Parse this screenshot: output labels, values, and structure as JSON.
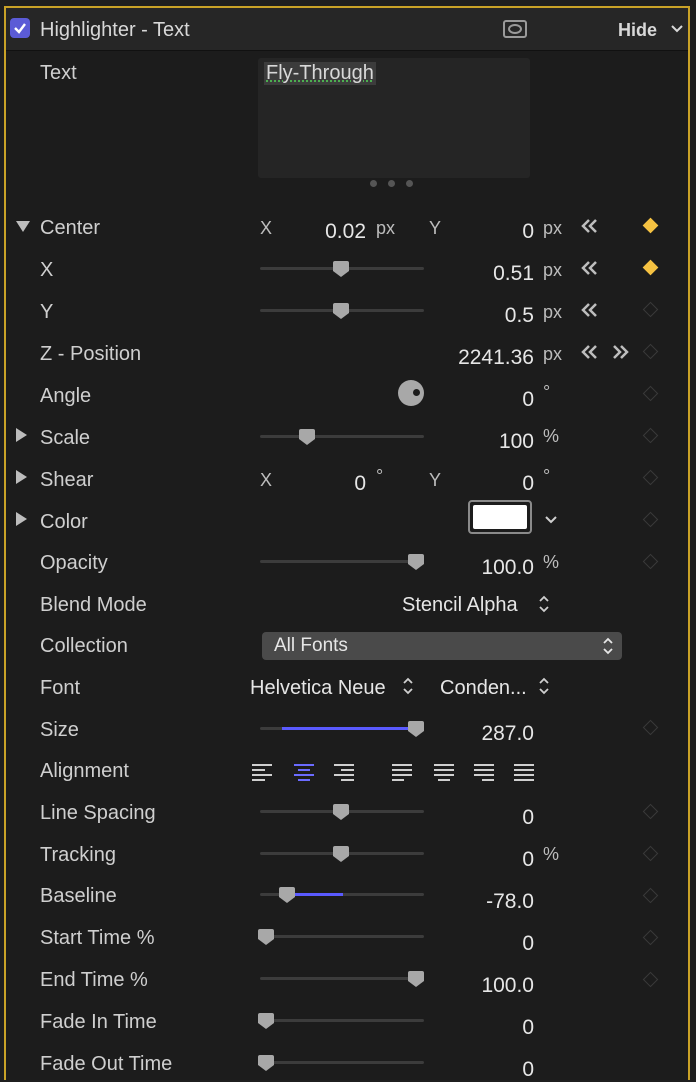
{
  "header": {
    "checkbox_checked": true,
    "title": "Highlighter - Text",
    "hide_label": "Hide"
  },
  "text_field": {
    "label": "Text",
    "value": "Fly-Through"
  },
  "rows": {
    "center": {
      "label": "Center",
      "x_label": "X",
      "x_value": "0.02",
      "x_unit": "px",
      "y_label": "Y",
      "y_value": "0",
      "y_unit": "px"
    },
    "x": {
      "label": "X",
      "value": "0.51",
      "unit": "px",
      "slider": 0.5
    },
    "y": {
      "label": "Y",
      "value": "0.5",
      "unit": "px",
      "slider": 0.5
    },
    "zpos": {
      "label": "Z - Position",
      "value": "2241.36",
      "unit": "px"
    },
    "angle": {
      "label": "Angle",
      "value": "0",
      "unit": "°"
    },
    "scale": {
      "label": "Scale",
      "value": "100",
      "unit": "%",
      "slider": 0.27
    },
    "shear": {
      "label": "Shear",
      "x_label": "X",
      "x_value": "0",
      "x_unit": "°",
      "y_label": "Y",
      "y_value": "0",
      "y_unit": "°"
    },
    "color": {
      "label": "Color",
      "swatch": "#ffffff"
    },
    "opacity": {
      "label": "Opacity",
      "value": "100.0",
      "unit": "%",
      "slider": 1.0
    },
    "blend": {
      "label": "Blend Mode",
      "value": "Stencil Alpha"
    },
    "collection": {
      "label": "Collection",
      "value": "All Fonts"
    },
    "font": {
      "label": "Font",
      "family": "Helvetica Neue",
      "style": "Conden..."
    },
    "size": {
      "label": "Size",
      "value": "287.0",
      "slider": 1.0
    },
    "alignment": {
      "label": "Alignment"
    },
    "line_spacing": {
      "label": "Line Spacing",
      "value": "0",
      "slider": 0.5
    },
    "tracking": {
      "label": "Tracking",
      "value": "0",
      "unit": "%",
      "slider": 0.5
    },
    "baseline": {
      "label": "Baseline",
      "value": "-78.0",
      "slider": 0.14
    },
    "start_time": {
      "label": "Start Time %",
      "value": "0",
      "slider": 0.0
    },
    "end_time": {
      "label": "End Time %",
      "value": "100.0",
      "slider": 1.0
    },
    "fade_in": {
      "label": "Fade In Time",
      "value": "0",
      "slider": 0.0
    },
    "fade_out": {
      "label": "Fade Out Time",
      "value": "0",
      "slider": 0.0
    }
  },
  "colors": {
    "accent": "#5a5aff",
    "keyframe_active": "#f5c242",
    "border": "#c9a227"
  }
}
